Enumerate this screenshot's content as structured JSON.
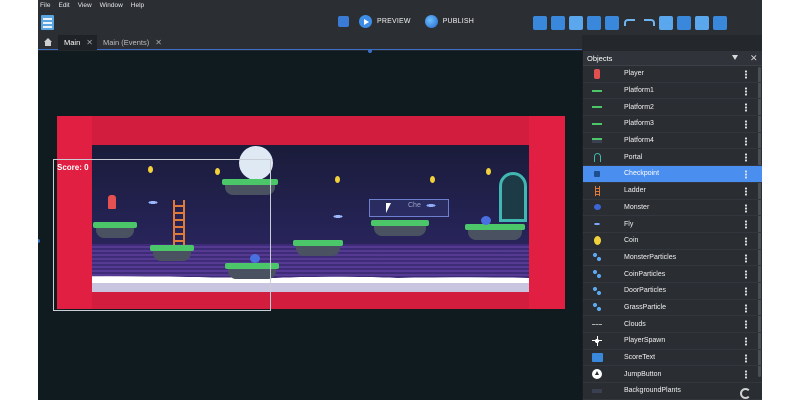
{
  "menu": {
    "items": [
      "File",
      "Edit",
      "View",
      "Window",
      "Help"
    ]
  },
  "toolbar": {
    "preview_label": "PREVIEW",
    "publish_label": "PUBLISH"
  },
  "tabs": [
    {
      "label": "Main",
      "active": true
    },
    {
      "label": "Main (Events)",
      "active": false
    }
  ],
  "game": {
    "score_text": "Score: 0",
    "ghost_label": "Che"
  },
  "objects_panel": {
    "title": "Objects",
    "items": [
      {
        "label": "Player",
        "icon": "player-icon"
      },
      {
        "label": "Platform1",
        "icon": "platform-icon"
      },
      {
        "label": "Platform2",
        "icon": "platform-icon"
      },
      {
        "label": "Platform3",
        "icon": "platform-icon"
      },
      {
        "label": "Platform4",
        "icon": "platform-icon"
      },
      {
        "label": "Portal",
        "icon": "portal-icon"
      },
      {
        "label": "Checkpoint",
        "icon": "checkpoint-icon",
        "selected": true
      },
      {
        "label": "Ladder",
        "icon": "ladder-icon"
      },
      {
        "label": "Monster",
        "icon": "monster-icon"
      },
      {
        "label": "Fly",
        "icon": "fly-icon"
      },
      {
        "label": "Coin",
        "icon": "coin-icon"
      },
      {
        "label": "MonsterParticles",
        "icon": "particles-icon"
      },
      {
        "label": "CoinParticles",
        "icon": "particles-icon"
      },
      {
        "label": "DoorParticles",
        "icon": "particles-icon"
      },
      {
        "label": "GrassParticle",
        "icon": "particles-icon"
      },
      {
        "label": "Clouds",
        "icon": "clouds-icon"
      },
      {
        "label": "PlayerSpawn",
        "icon": "spawn-icon"
      },
      {
        "label": "ScoreText",
        "icon": "text-icon"
      },
      {
        "label": "JumpButton",
        "icon": "jump-button-icon"
      },
      {
        "label": "BackgroundPlants",
        "icon": "background-plants-icon"
      }
    ]
  },
  "colors": {
    "accent": "#4a8ef0",
    "editor_bg": "#0f1b1e",
    "level_border_red": "#d21d3f",
    "platform_green": "#4bc76a"
  }
}
